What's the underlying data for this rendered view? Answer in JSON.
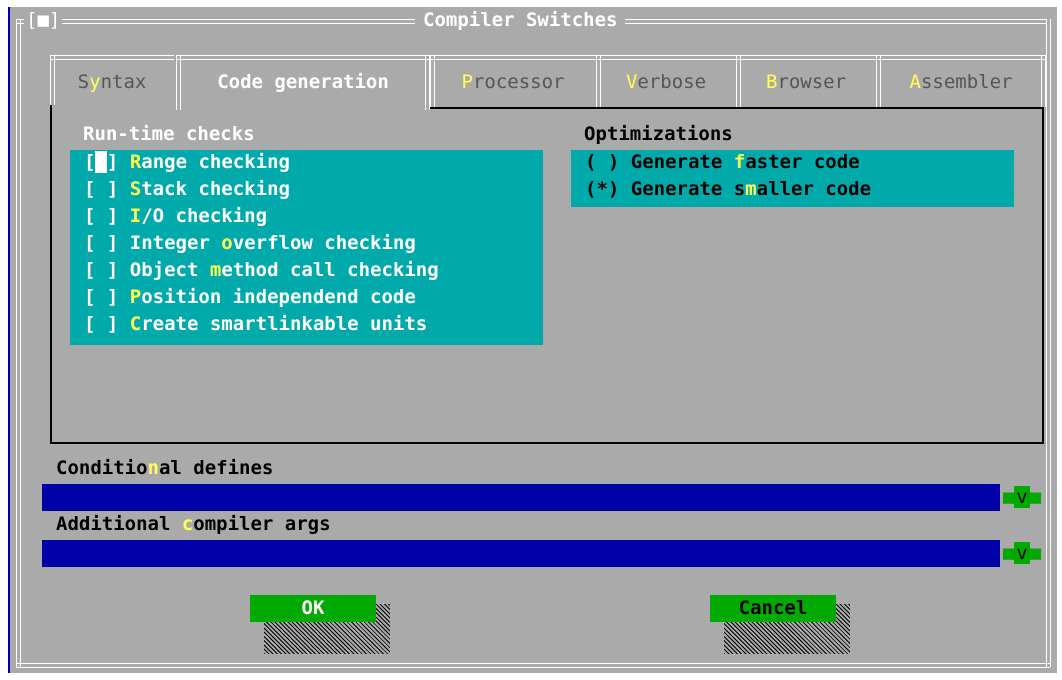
{
  "window": {
    "close_button": "[■]",
    "title": "Compiler Switches"
  },
  "tabs": [
    {
      "pre": "S",
      "hot": "y",
      "post": "ntax"
    },
    {
      "pre": "",
      "hot": "",
      "post": "Code generation"
    },
    {
      "pre": "",
      "hot": "P",
      "post": "rocessor"
    },
    {
      "pre": "",
      "hot": "V",
      "post": "erbose"
    },
    {
      "pre": "",
      "hot": "B",
      "post": "rowser"
    },
    {
      "pre": "",
      "hot": "A",
      "post": "ssembler"
    }
  ],
  "runtime_checks": {
    "title": "Run-time checks",
    "items": [
      {
        "box": "[ ]",
        "pre": "",
        "hot": "R",
        "post": "ange checking"
      },
      {
        "box": "[ ]",
        "pre": "",
        "hot": "S",
        "post": "tack checking"
      },
      {
        "box": "[ ]",
        "pre": "",
        "hot": "I",
        "post": "/O checking"
      },
      {
        "box": "[ ]",
        "pre": "Integer ",
        "hot": "o",
        "post": "verflow checking"
      },
      {
        "box": "[ ]",
        "pre": "Object ",
        "hot": "m",
        "post": "ethod call checking"
      },
      {
        "box": "[ ]",
        "pre": "",
        "hot": "P",
        "post": "osition independend code"
      },
      {
        "box": "[ ]",
        "pre": "",
        "hot": "C",
        "post": "reate smartlinkable units"
      }
    ]
  },
  "optimizations": {
    "title": "Optimizations",
    "items": [
      {
        "box": "( )",
        "pre": "Generate ",
        "hot": "f",
        "post": "aster code"
      },
      {
        "box": "(*)",
        "pre": "Generate s",
        "hot": "m",
        "post": "aller code"
      }
    ]
  },
  "conditional_defines": {
    "label_pre": "Conditio",
    "label_hot": "n",
    "label_post": "al defines",
    "value": "",
    "history_button": "v"
  },
  "additional_args": {
    "label_pre": "Additional ",
    "label_hot": "c",
    "label_post": "ompiler args",
    "value": "",
    "history_button": "v"
  },
  "buttons": {
    "ok": "OK",
    "cancel": "Cancel"
  },
  "colors": {
    "dialog_bg": "#aaaaaa",
    "cyan": "#00aaaa",
    "input_blue": "#0000a8",
    "hotkey": "#ffff55",
    "button_green": "#00aa00"
  }
}
